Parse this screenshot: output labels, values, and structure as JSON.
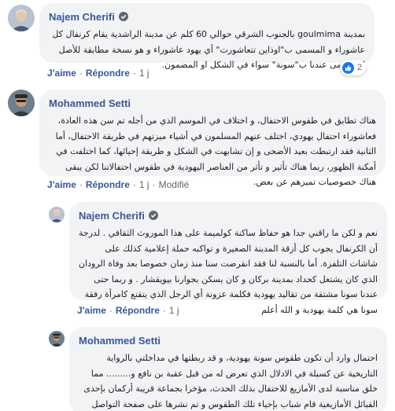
{
  "comments": [
    {
      "author": "Najem Cherifi",
      "text": "بمدينة goulmima بالجنوب الشرقي حوالي 60 كلم عن مدينة الراشدية يقام كرنفال كل عاشوراء و المسمى ب\"اوذاين تتعاشورت\" أي يهود عاشوراء و هو نسخة مطابقة للأصل لما يسمى عندنا ب\"سونة\" سواء في الشكل او المضمون.",
      "like": "J'aime",
      "reply": "Répondre",
      "time": "1 j",
      "reaction_count": "2"
    },
    {
      "author": "Mohammed Setti",
      "text": "هناك تطابق في طقوس الاحتفال، و اختلاف في الموسم الذي من أجله تم سن هذه العادة، فعاشوراء احتفال يهودي، اختلف عنهم المسلمون في أشياء ميزتهم في طريقة الاحتفال، أما الثانية فقد ارتبطت بعيد الأضحى و إن تشابهت في الشكل و طريقة إحيائها، كما اختلفت في أمكنة الظهور، ربما هناك تأثير و تأثر من العناصر اليهودية في طقوس احتفالاتنا لكن يبقى هناك خصوصيات تميزهم عن بعض.",
      "like": "J'aime",
      "reply": "Répondre",
      "time": "1 j",
      "edited": "Modifié"
    },
    {
      "author": "Najem Cherifi",
      "text": "نعم و لكن ما راقني جدا هو حفاظ ساكنة كولميمة على هذا الموروث الثقافي . لدرجة أن الكرنفال يجوب كل أزقة المدينة الصغيرة و تواكبه حملة إعلامية كذلك على شاشات التلفزة. أما بالنسبة لنا فقد انقرضت سنا منذ زمان خصوصا بعد وفاة الرودان الذي كان يشتغل كحداد بمدينة بركان و كان يسكن بجوارنا بيويقشار . و ربما حتى عندنا سونا مشتقة من تقاليد يهودية فكلمة عزونة أي الرجل الذي يتقنع كامرأة رفقة سونا هي كلمة يهودية و الله أعلم",
      "like": "J'aime",
      "reply": "Répondre",
      "time": "1 j"
    },
    {
      "author": "Mohammed Setti",
      "text": "احتمال وارد أن تكون طقوس سونة يهودية، و قد ربطتها في مداخلتي بالرواية التاريخية عن كسيلة في الادلال الذي تعرض له من قبل عقبة بن نافع و......... مما خلق مناسبة لدى الأمازيغ للاحتفال بذلك الحدث، مؤخرا بجماعة قريبة أركمان بإحدى القبائل الأمازيغية قام شباب بإحياء تلك الطقوس و تم نشرها على صفحة التواصل الاجتماعي، و منها اعتمدت الصورة المرفقة بالموضوع."
    }
  ],
  "colors": {
    "author": "#385898",
    "bubble": "#f2f3f5",
    "like_reaction": "#1877f2",
    "meta": "#606770"
  },
  "icons": {
    "verified": "verified-badge-icon",
    "like": "thumbs-up-icon"
  }
}
